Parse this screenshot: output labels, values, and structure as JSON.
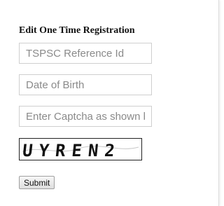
{
  "form": {
    "title": "Edit One Time Registration",
    "reference_placeholder": "TSPSC Reference Id",
    "dob_placeholder": "Date of Birth",
    "captcha_placeholder": "Enter Captcha as shown below",
    "captcha_text": "UYREN2",
    "submit_label": "Submit"
  }
}
